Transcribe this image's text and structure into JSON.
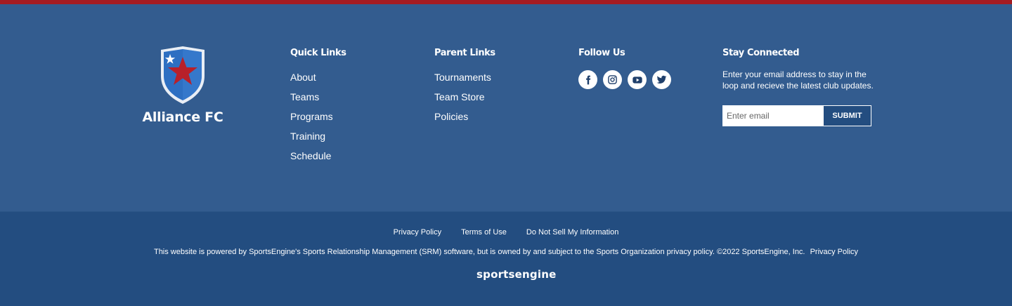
{
  "club": {
    "name": "Alliance FC"
  },
  "colors": {
    "stripe": "#a51c22",
    "footer_main": "#335c8f",
    "footer_bottom": "#234d80",
    "shield": "#2d6fc2",
    "star": "#b8202a"
  },
  "quick_links": {
    "title": "Quick Links",
    "items": [
      {
        "label": "About"
      },
      {
        "label": "Teams"
      },
      {
        "label": "Programs"
      },
      {
        "label": "Training"
      },
      {
        "label": "Schedule"
      }
    ]
  },
  "parent_links": {
    "title": "Parent Links",
    "items": [
      {
        "label": "Tournaments"
      },
      {
        "label": "Team Store"
      },
      {
        "label": "Policies"
      }
    ]
  },
  "follow_us": {
    "title": "Follow Us",
    "icons": [
      "facebook-icon",
      "instagram-icon",
      "youtube-icon",
      "twitter-icon"
    ]
  },
  "stay_connected": {
    "title": "Stay Connected",
    "text": "Enter your email address to stay in the loop and  recieve the latest club updates.",
    "placeholder": "Enter email",
    "submit_label": "SUBMIT"
  },
  "legal": {
    "links": [
      {
        "label": "Privacy Policy"
      },
      {
        "label": "Terms of Use"
      },
      {
        "label": "Do Not Sell My Information"
      }
    ],
    "powered_text": "This website is powered by SportsEngine's Sports Relationship Management (SRM) software, but is owned by and subject to the Sports Organization privacy policy. ©2022 SportsEngine, Inc.",
    "powered_privacy": "Privacy Policy",
    "sportsengine_logo": "sportsengine"
  }
}
